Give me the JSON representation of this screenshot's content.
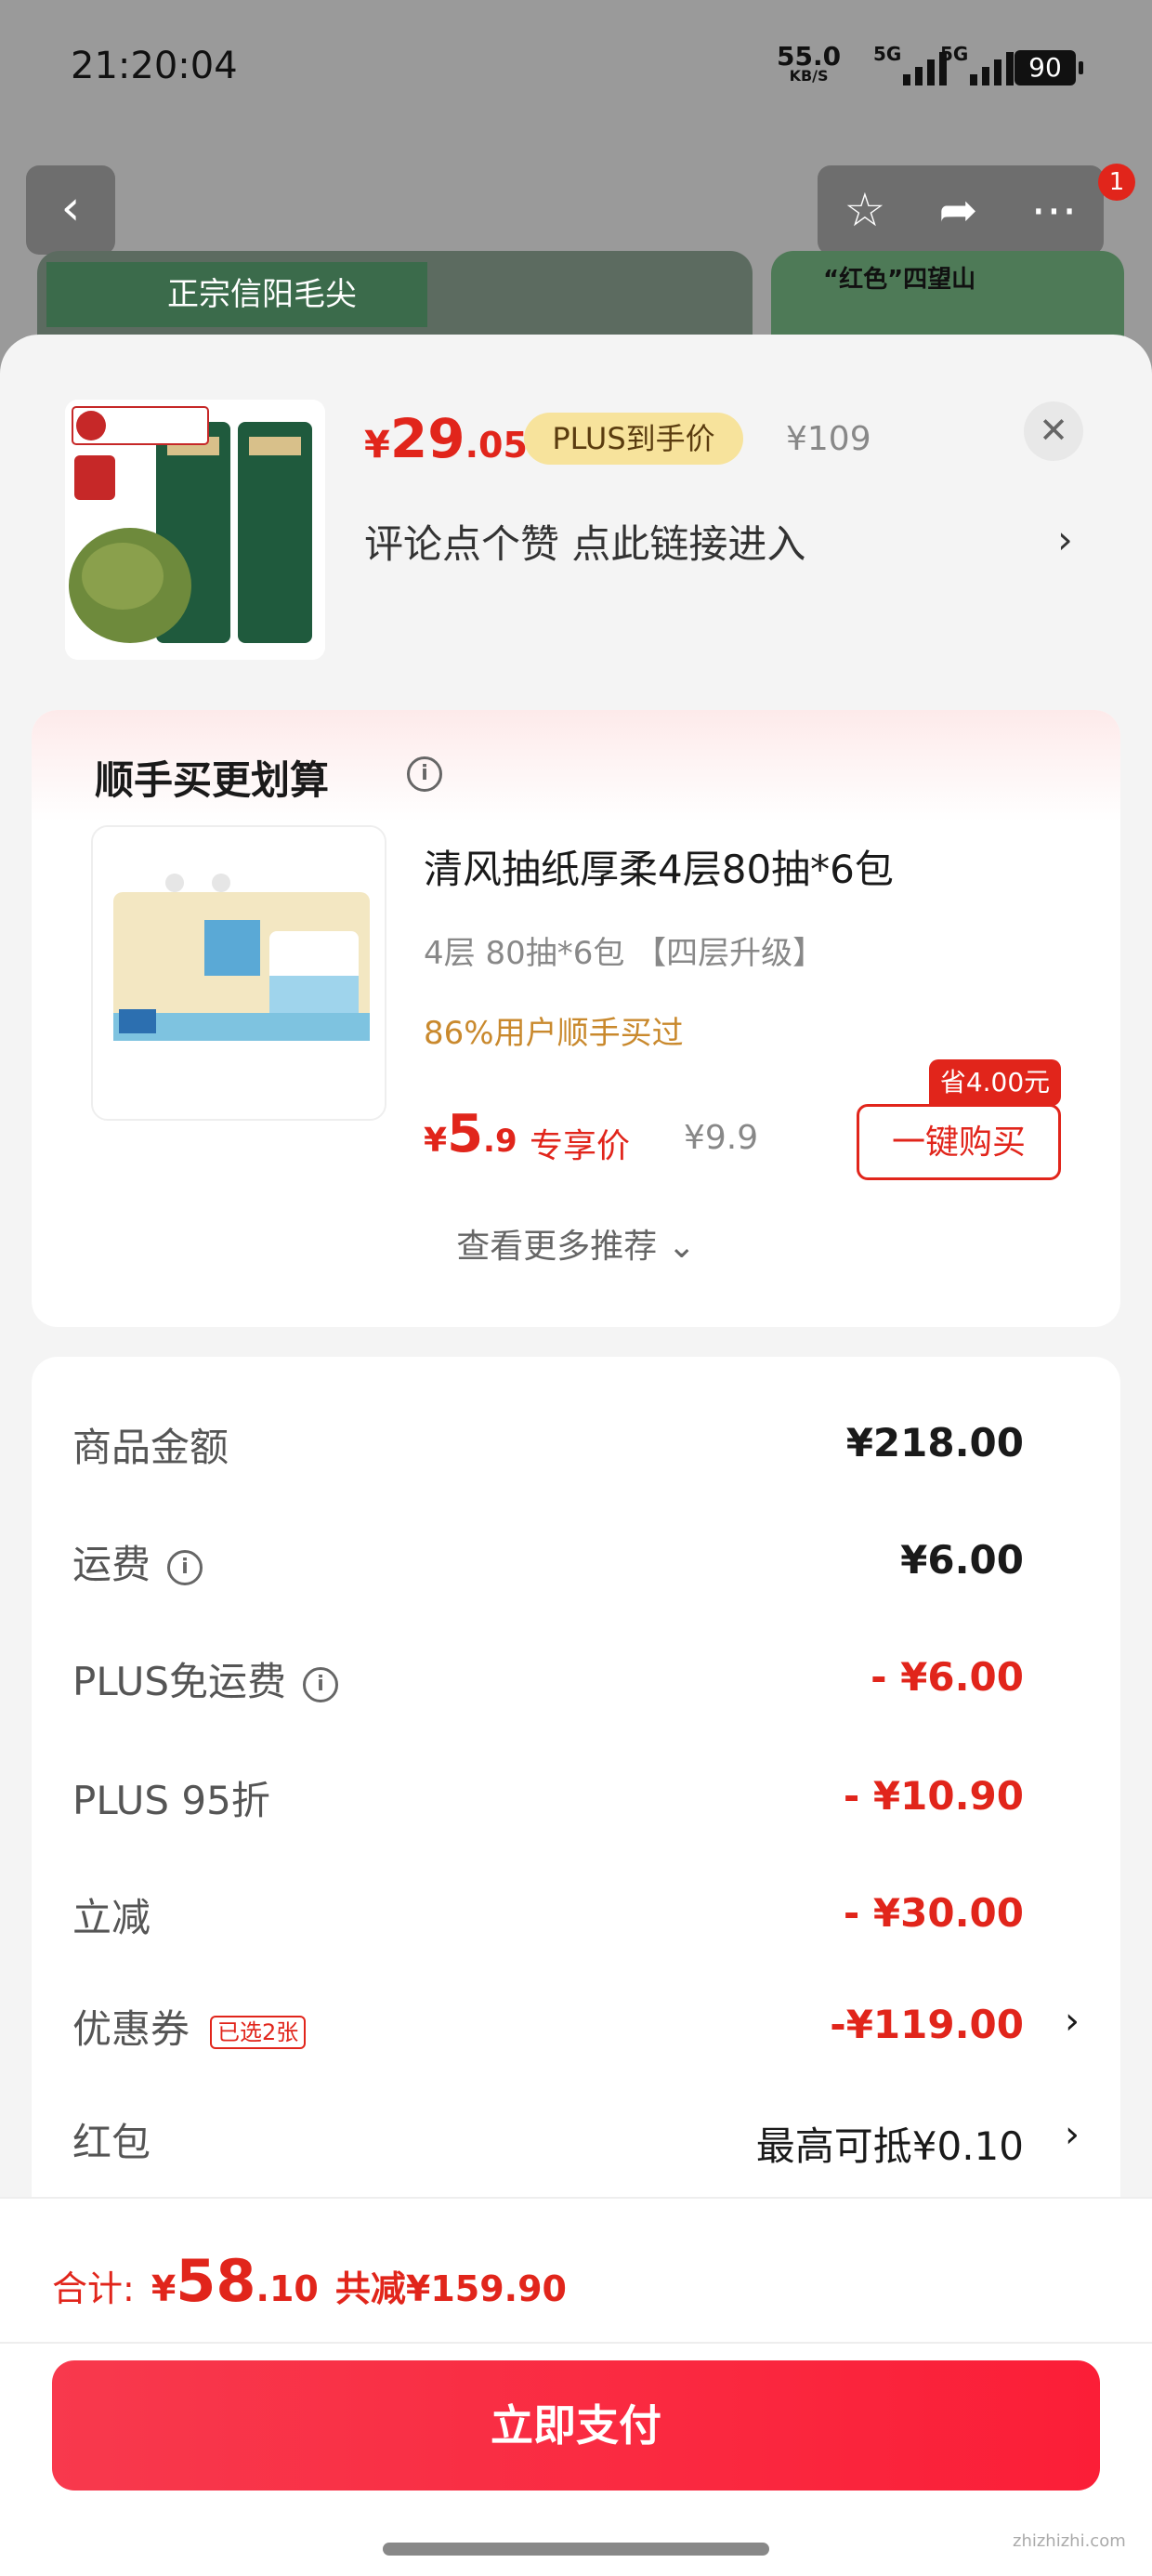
{
  "status": {
    "time": "21:20:04",
    "net_speed": "55.0",
    "net_unit": "KB/S",
    "sim1": "5G",
    "sim2": "5G",
    "battery": "90"
  },
  "nav": {
    "notif_count": "1",
    "bg_label1": "正宗信阳毛尖",
    "bg_label2": "“红色”四望山"
  },
  "product": {
    "price_currency": "¥",
    "price_int": "29",
    "price_dec": ".05",
    "plus_tag": "PLUS到手价",
    "orig_price": "¥109",
    "close": "✕",
    "promo": "评论点个赞  点此链接进入",
    "promo_chevron": "›"
  },
  "bundle": {
    "title": "顺手买更划算",
    "info": "i",
    "item_name": "清风抽纸厚柔4层80抽*6包",
    "item_spec": "4层 80抽*6包 【四层升级】",
    "item_social": "86%用户顺手买过",
    "price_currency": "¥",
    "price_int": "5",
    "price_dec": ".9",
    "price_label": "专享价",
    "orig_price": "¥9.9",
    "save_badge": "省4.00元",
    "buy_label": "一键购买",
    "more_label": "查看更多推荐 ⌄"
  },
  "summary": {
    "rows": [
      {
        "label": "商品金额",
        "value": "¥218.00"
      },
      {
        "label": "运费",
        "value": "¥6.00"
      },
      {
        "label": "PLUS免运费",
        "value": "- ¥6.00"
      },
      {
        "label": "PLUS 95折",
        "value": "- ¥10.90"
      },
      {
        "label": "立减",
        "value": "- ¥30.00"
      },
      {
        "label": "优惠券",
        "tag": "已选2张",
        "value": "-¥119.00",
        "chevron": "›"
      },
      {
        "label": "红包",
        "value": "最高可抵¥0.10",
        "chevron": "›"
      }
    ]
  },
  "footer": {
    "total_label": "合计:",
    "total_currency": "¥",
    "total_int": "58",
    "total_dec": ".10",
    "saved": "共减¥159.90",
    "pay_label": "立即支付",
    "watermark": "zhizhizhi.com"
  },
  "colors": {
    "accent": "#e1251b",
    "pay_button": "#fb1e37",
    "plus_tag_bg": "#f7e39c"
  },
  "icons": [
    "back-icon",
    "star-icon",
    "share-icon",
    "more-icon",
    "close-icon",
    "info-icon",
    "chevron-right-icon"
  ]
}
